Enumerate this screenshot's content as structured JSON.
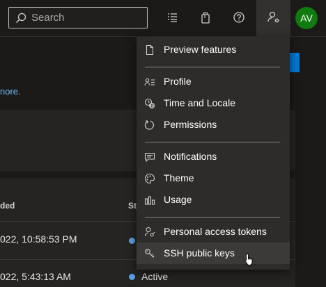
{
  "header": {
    "search_placeholder": "Search",
    "avatar_initials": "AV"
  },
  "page": {
    "more_link": "nore.",
    "table": {
      "columns": [
        "ded",
        "St"
      ],
      "rows": [
        {
          "date": "022, 10:58:53 PM",
          "status": ""
        },
        {
          "date": "022, 5:43:13 AM",
          "status": "Active"
        }
      ]
    }
  },
  "menu": {
    "items": [
      {
        "label": "Preview features",
        "icon": "document-icon"
      },
      {
        "label": "Profile",
        "icon": "profile-icon"
      },
      {
        "label": "Time and Locale",
        "icon": "globe-clock-icon"
      },
      {
        "label": "Permissions",
        "icon": "refresh-icon"
      },
      {
        "label": "Notifications",
        "icon": "chat-icon"
      },
      {
        "label": "Theme",
        "icon": "palette-icon"
      },
      {
        "label": "Usage",
        "icon": "bar-chart-icon"
      },
      {
        "label": "Personal access tokens",
        "icon": "person-key-icon"
      },
      {
        "label": "SSH public keys",
        "icon": "key-icon"
      }
    ]
  },
  "colors": {
    "accent": "#0078d4",
    "avatar": "#107c10",
    "link": "#6cb8f6",
    "status_dot": "#5a9fe4"
  }
}
